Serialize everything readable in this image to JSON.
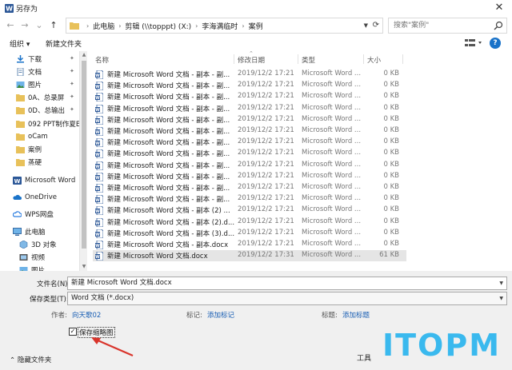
{
  "window": {
    "title": "另存为",
    "close_glyph": "✕"
  },
  "nav_buttons": {
    "back": "←",
    "forward": "→",
    "recent": "⌄",
    "up": "↑"
  },
  "address": {
    "crumbs": [
      "此电脑",
      "剪辑 (\\\\topppt) (X:)",
      "李海满临时",
      "案例"
    ],
    "separator": "›"
  },
  "search": {
    "placeholder": "搜索\"案例\""
  },
  "toolbar": {
    "organize_label": "组织 ▾",
    "new_folder_label": "新建文件夹",
    "help_label": "?"
  },
  "sidebar": {
    "items": [
      {
        "label": "下载",
        "icon": "download-icon",
        "pinned": true
      },
      {
        "label": "文档",
        "icon": "document-icon",
        "pinned": true
      },
      {
        "label": "图片",
        "icon": "pictures-icon",
        "pinned": true
      },
      {
        "label": "0A、总录屏",
        "icon": "folder-icon",
        "pinned": true
      },
      {
        "label": "0D、总输出",
        "icon": "folder-icon",
        "pinned": true
      },
      {
        "label": "092 PPT制作夏E",
        "icon": "folder-icon",
        "pinned": false
      },
      {
        "label": "oCam",
        "icon": "folder-icon",
        "pinned": false
      },
      {
        "label": "案例",
        "icon": "folder-icon",
        "pinned": false
      },
      {
        "label": "蒸硬",
        "icon": "folder-icon",
        "pinned": false
      },
      {
        "label": "Microsoft Word",
        "icon": "word-icon",
        "pinned": false
      },
      {
        "label": "OneDrive",
        "icon": "cloud-icon",
        "pinned": false
      },
      {
        "label": "WPS网盘",
        "icon": "wps-cloud-icon",
        "pinned": false
      },
      {
        "label": "此电脑",
        "icon": "computer-icon",
        "pinned": false
      },
      {
        "label": "3D 对象",
        "icon": "3d-objects-icon",
        "pinned": false
      },
      {
        "label": "视频",
        "icon": "video-icon",
        "pinned": false
      },
      {
        "label": "图片",
        "icon": "pictures-icon",
        "pinned": false
      }
    ]
  },
  "file_list": {
    "columns": {
      "name": "名称",
      "date": "修改日期",
      "type": "类型",
      "size": "大小"
    },
    "rows": [
      {
        "name": "新建 Microsoft Word 文档 - 副本 - 副...",
        "date": "2019/12/2 17:21",
        "type": "Microsoft Word ...",
        "size": "0 KB"
      },
      {
        "name": "新建 Microsoft Word 文档 - 副本 - 副...",
        "date": "2019/12/2 17:21",
        "type": "Microsoft Word ...",
        "size": "0 KB"
      },
      {
        "name": "新建 Microsoft Word 文档 - 副本 - 副...",
        "date": "2019/12/2 17:21",
        "type": "Microsoft Word ...",
        "size": "0 KB"
      },
      {
        "name": "新建 Microsoft Word 文档 - 副本 - 副...",
        "date": "2019/12/2 17:21",
        "type": "Microsoft Word ...",
        "size": "0 KB"
      },
      {
        "name": "新建 Microsoft Word 文档 - 副本 - 副...",
        "date": "2019/12/2 17:21",
        "type": "Microsoft Word ...",
        "size": "0 KB"
      },
      {
        "name": "新建 Microsoft Word 文档 - 副本 - 副...",
        "date": "2019/12/2 17:21",
        "type": "Microsoft Word ...",
        "size": "0 KB"
      },
      {
        "name": "新建 Microsoft Word 文档 - 副本 - 副...",
        "date": "2019/12/2 17:21",
        "type": "Microsoft Word ...",
        "size": "0 KB"
      },
      {
        "name": "新建 Microsoft Word 文档 - 副本 - 副...",
        "date": "2019/12/2 17:21",
        "type": "Microsoft Word ...",
        "size": "0 KB"
      },
      {
        "name": "新建 Microsoft Word 文档 - 副本 - 副...",
        "date": "2019/12/2 17:21",
        "type": "Microsoft Word ...",
        "size": "0 KB"
      },
      {
        "name": "新建 Microsoft Word 文档 - 副本 - 副...",
        "date": "2019/12/2 17:21",
        "type": "Microsoft Word ...",
        "size": "0 KB"
      },
      {
        "name": "新建 Microsoft Word 文档 - 副本 - 副...",
        "date": "2019/12/2 17:21",
        "type": "Microsoft Word ...",
        "size": "0 KB"
      },
      {
        "name": "新建 Microsoft Word 文档 - 副本 - 副...",
        "date": "2019/12/2 17:21",
        "type": "Microsoft Word ...",
        "size": "0 KB"
      },
      {
        "name": "新建 Microsoft Word 文档 - 副本 (2) ...",
        "date": "2019/12/2 17:21",
        "type": "Microsoft Word ...",
        "size": "0 KB"
      },
      {
        "name": "新建 Microsoft Word 文档 - 副本 (2).d...",
        "date": "2019/12/2 17:21",
        "type": "Microsoft Word ...",
        "size": "0 KB"
      },
      {
        "name": "新建 Microsoft Word 文档 - 副本 (3).d...",
        "date": "2019/12/2 17:21",
        "type": "Microsoft Word ...",
        "size": "0 KB"
      },
      {
        "name": "新建 Microsoft Word 文档 - 副本.docx",
        "date": "2019/12/2 17:21",
        "type": "Microsoft Word ...",
        "size": "0 KB"
      },
      {
        "name": "新建 Microsoft Word 文档.docx",
        "date": "2019/12/2 17:31",
        "type": "Microsoft Word ...",
        "size": "61 KB"
      }
    ]
  },
  "form": {
    "filename_label": "文件名(N):",
    "filename_value": "新建 Microsoft Word 文档.docx",
    "filetype_label": "保存类型(T):",
    "filetype_value": "Word 文档 (*.docx)",
    "author_label": "作者:",
    "author_value": "向天歌02",
    "tags_label": "标记:",
    "tags_value": "添加标记",
    "title_label": "标题:",
    "title_value": "添加标题",
    "thumbnail_label": "保存缩略图",
    "thumbnail_checked": true
  },
  "bottom": {
    "hide_folders_label": "⌃ 隐藏文件夹",
    "tools_label": "工具"
  },
  "watermark": {
    "text": "ITOPM"
  },
  "colors": {
    "accent": "#1a73c9",
    "link": "#1a5fb4",
    "selection": "#e5e5e5",
    "annotation_arrow": "#d9342b",
    "watermark": "#3ab9ee"
  }
}
